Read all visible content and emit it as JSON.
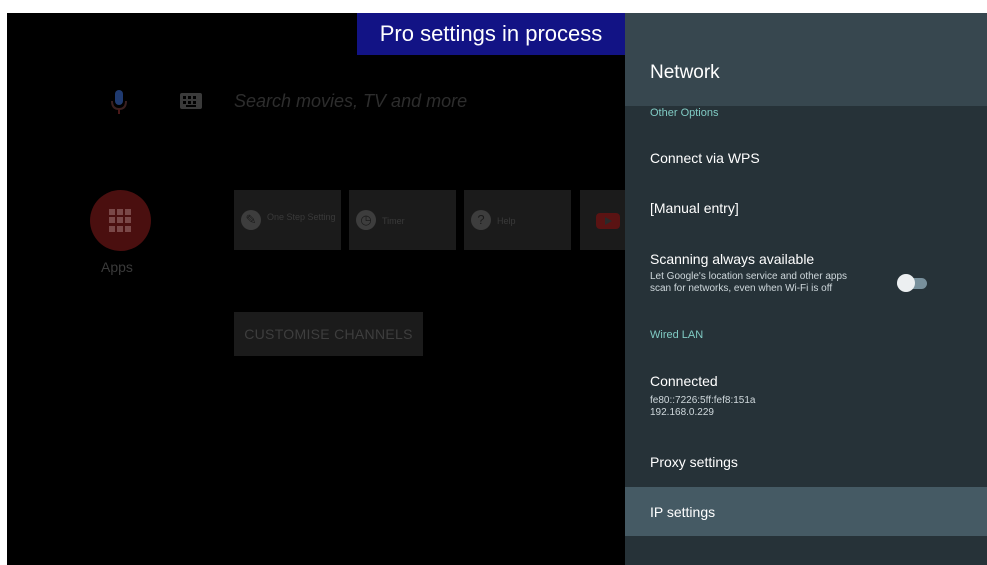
{
  "banner": {
    "text": "Pro settings in process"
  },
  "home": {
    "search_placeholder": "Search movies, TV and more",
    "apps_label": "Apps",
    "tiles": [
      {
        "label": "One Step Setting",
        "icon": "wrench-icon"
      },
      {
        "label": "Timer",
        "icon": "clock-icon"
      },
      {
        "label": "Help",
        "icon": "question-icon"
      },
      {
        "label": "",
        "icon": "youtube-icon"
      }
    ],
    "customise_button": "CUSTOMISE CHANNELS"
  },
  "panel": {
    "title": "Network",
    "section_other": "Other Options",
    "connect_wps": "Connect via WPS",
    "manual_entry": "[Manual entry]",
    "scanning": {
      "title": "Scanning always available",
      "desc_line1": "Let Google's location service and other apps",
      "desc_line2": "scan for networks, even when Wi-Fi is off",
      "enabled": false
    },
    "section_wired": "Wired LAN",
    "connected": {
      "title": "Connected",
      "ipv6": "fe80::7226:5ff:fef8:151a",
      "ipv4": "192.168.0.229"
    },
    "proxy_settings": "Proxy settings",
    "ip_settings": "IP settings"
  },
  "colors": {
    "panel_bg": "#263238",
    "panel_header": "#37474f",
    "section_accent": "#80cbc4",
    "selected_row": "#455a64",
    "banner_bg": "#121385"
  }
}
